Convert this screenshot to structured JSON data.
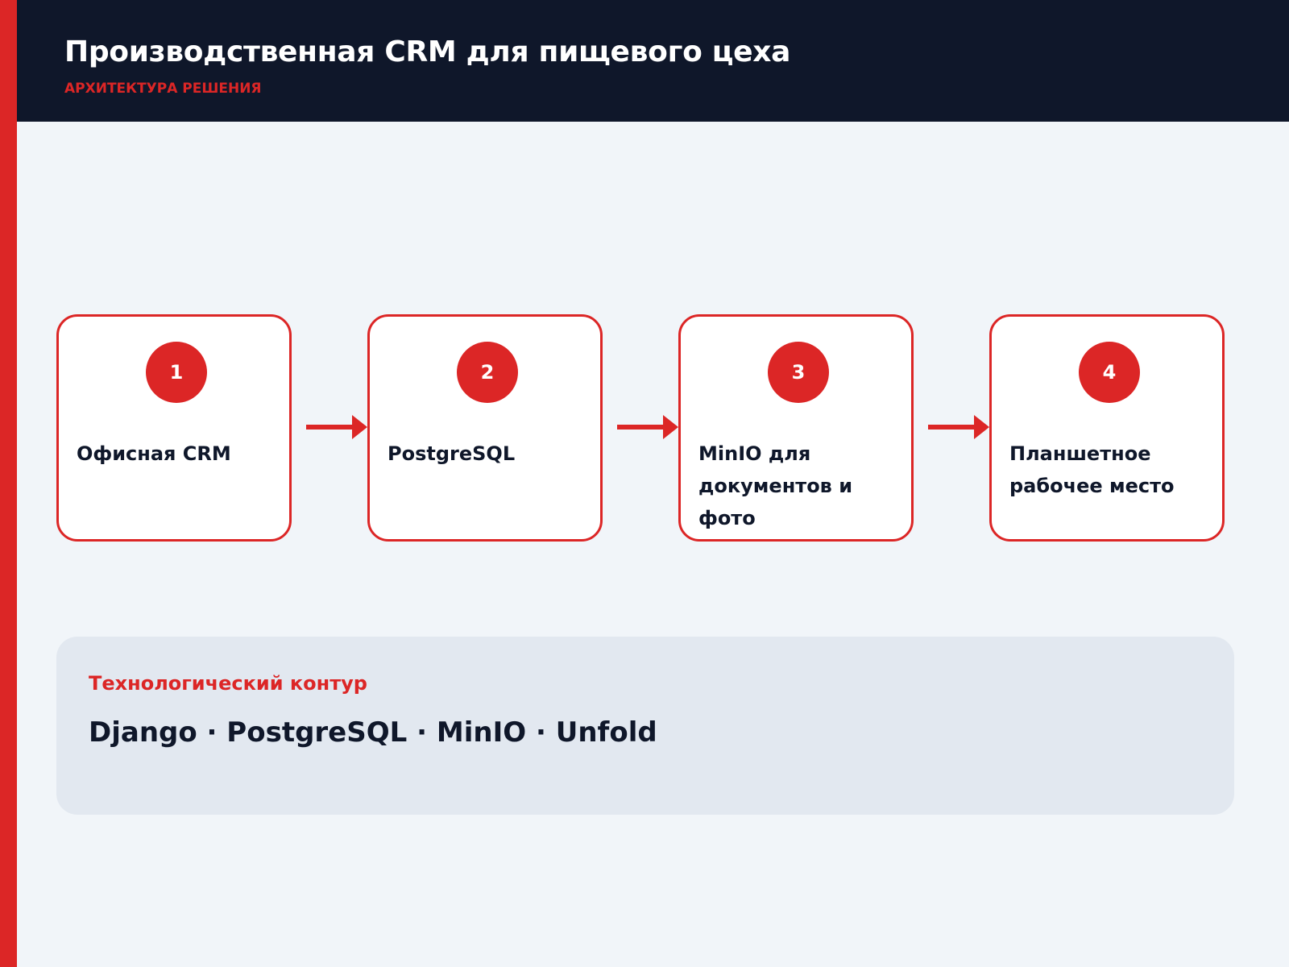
{
  "header": {
    "title": "Производственная CRM для пищевого цеха",
    "subtitle": "АРХИТЕКТУРА РЕШЕНИЯ"
  },
  "flow": {
    "steps": [
      {
        "number": "1",
        "label": "Офисная CRM"
      },
      {
        "number": "2",
        "label": "PostgreSQL"
      },
      {
        "number": "3",
        "label": "MinIO для документов и фото"
      },
      {
        "number": "4",
        "label": "Планшетное рабочее место"
      }
    ]
  },
  "tech": {
    "heading": "Технологический контур",
    "stack": "Django · PostgreSQL · MinIO · Unfold"
  },
  "colors": {
    "accent": "#dc2626",
    "header_background": "#0f172a",
    "page_background": "#f1f5f9",
    "panel_background": "#e2e8f0",
    "text": "#0f172a"
  },
  "icons": {
    "connector": "arrow-right-icon"
  }
}
